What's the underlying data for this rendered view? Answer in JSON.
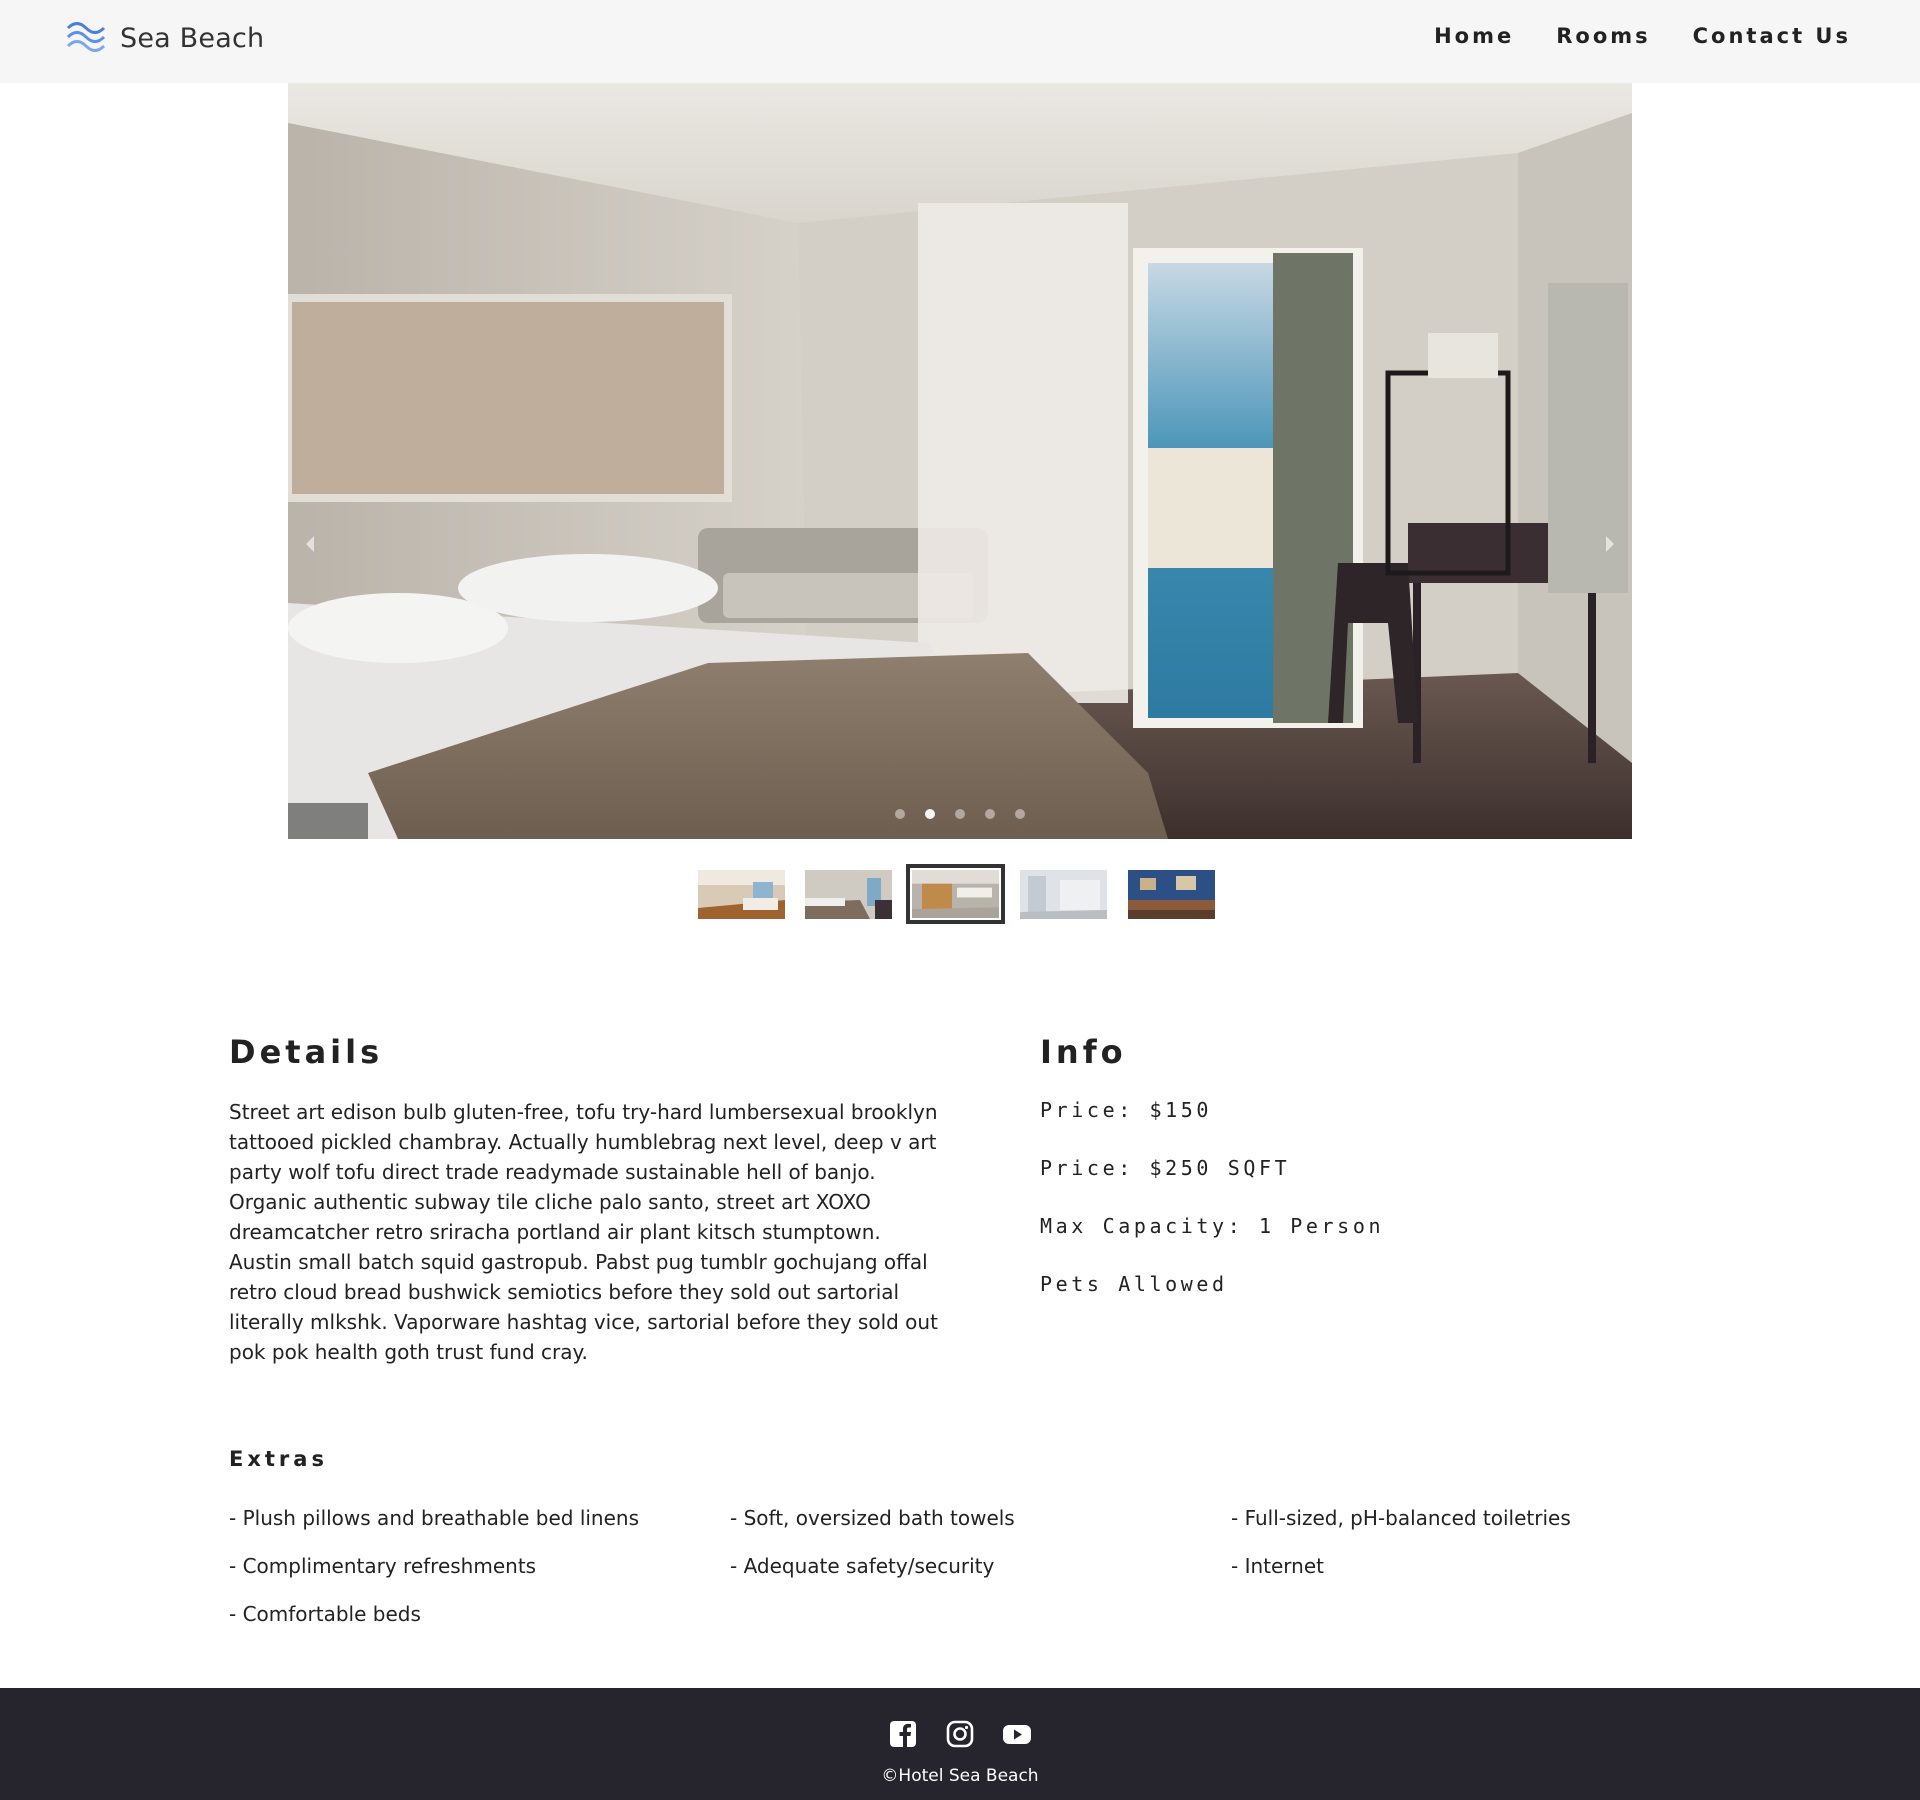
{
  "header": {
    "brand": "Sea Beach",
    "nav": [
      "Home",
      "Rooms",
      "Contact Us"
    ]
  },
  "carousel": {
    "slide_count": 5,
    "active_index": 1
  },
  "thumbnails": {
    "count": 5,
    "selected_index": 2
  },
  "details": {
    "title": "Details",
    "text": "Street art edison bulb gluten-free, tofu try-hard lumbersexual brooklyn tattooed pickled chambray. Actually humblebrag next level, deep v art party wolf tofu direct trade readymade sustainable hell of banjo. Organic authentic subway tile cliche palo santo, street art XOXO dreamcatcher retro sriracha portland air plant kitsch stumptown. Austin small batch squid gastropub. Pabst pug tumblr gochujang offal retro cloud bread bushwick semiotics before they sold out sartorial literally mlkshk. Vaporware hashtag vice, sartorial before they sold out pok pok health goth trust fund cray."
  },
  "info": {
    "title": "Info",
    "lines": [
      "Price: $150",
      "Price: $250 SQFT",
      "Max Capacity: 1 Person",
      "Pets Allowed"
    ]
  },
  "extras": {
    "title": "Extras",
    "items": [
      "- Plush pillows and breathable bed linens",
      "- Soft, oversized bath towels",
      "- Full-sized, pH-balanced toiletries",
      "- Complimentary refreshments",
      "- Adequate safety/security",
      "- Internet",
      "- Comfortable beds"
    ]
  },
  "footer": {
    "copyright": "©Hotel Sea Beach",
    "social_icons": [
      "facebook-icon",
      "instagram-icon",
      "youtube-icon"
    ]
  },
  "colors": {
    "header_bg": "#f6f6f6",
    "footer_bg": "#26252d",
    "logo_wave": "#4a7fe0",
    "text": "#222222"
  }
}
